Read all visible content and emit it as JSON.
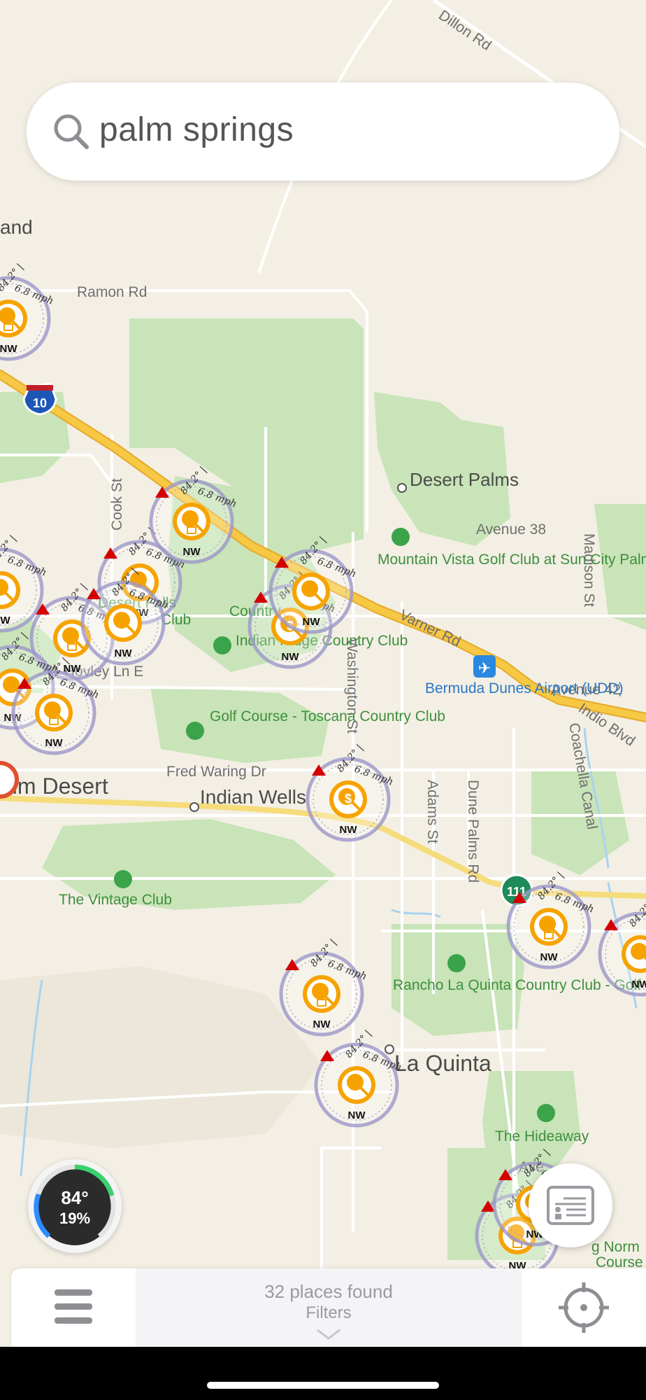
{
  "search": {
    "query": "palm springs"
  },
  "map": {
    "places": [
      {
        "name": "Desert Palms",
        "kind": "locality-sm"
      },
      {
        "name": "Mountain Vista Golf Club at Sun City Palm Desert",
        "kind": "golf"
      },
      {
        "name": "Bermuda Dunes Airport (UDD)",
        "kind": "airport"
      },
      {
        "name": "Golf Course - Toscana Country Club",
        "kind": "golf"
      },
      {
        "name": "Indian Ridge Country Club",
        "kind": "golf"
      },
      {
        "name": "Palm Desert",
        "kind": "city"
      },
      {
        "name": "Indian Wells",
        "kind": "city"
      },
      {
        "name": "The Vintage Club",
        "kind": "golf"
      },
      {
        "name": "Rancho La Quinta Country Club - Golf Course",
        "kind": "golf"
      },
      {
        "name": "La Quinta",
        "kind": "city"
      },
      {
        "name": "The Hideaway",
        "kind": "golf"
      }
    ],
    "roads": {
      "dillon": "Dillon Rd",
      "ramon": "Ramon Rd",
      "cook": "Cook St",
      "avenue38": "Avenue 38",
      "madison": "Madison St",
      "varner": "Varner Rd",
      "washington": "Washington St",
      "avenue42": "Avenue 42",
      "indio": "Indio Blvd",
      "coachella": "Coachella Canal",
      "fredwaring": "Fred Waring Dr",
      "adams": "Adams St",
      "dunepalms": "Dune Palms Rd",
      "hovley": "Hovley Ln E",
      "ave": "Ave",
      "and": "and",
      "alm": "alm Desert",
      "desertfalls": "Desert Falls",
      "club": "Club",
      "country": "Country",
      "norm": "g Norm",
      "course": "Course"
    },
    "shields": {
      "i10": "10",
      "ca111": "111"
    },
    "wind": {
      "temp_label": "84.2°",
      "speed_label": "6.8 mph",
      "dir_label": "NW"
    },
    "pins": [
      {
        "icon": "lock"
      },
      {
        "icon": "plain"
      },
      {
        "icon": "lock"
      },
      {
        "icon": "plain"
      },
      {
        "icon": "lock"
      },
      {
        "icon": "plain"
      },
      {
        "icon": "plain"
      },
      {
        "icon": "dollar"
      },
      {
        "icon": "plain"
      },
      {
        "icon": "lock"
      },
      {
        "icon": "dollar"
      },
      {
        "icon": "lock"
      },
      {
        "icon": "plain"
      },
      {
        "icon": "lock"
      },
      {
        "icon": "plain"
      },
      {
        "icon": "lock"
      },
      {
        "icon": "plain"
      }
    ],
    "colors": {
      "land": "#f3efe4",
      "park": "#c8e4b8",
      "road_main": "#ffffff",
      "highway": "#f6c843",
      "highway_edge": "#e6a92a",
      "water": "#a8d2f0",
      "pin_fill": "#f6a300",
      "pin_ring": "#9b96c8",
      "pin_arrow": "#d40000",
      "text_road": "#6f6f6f",
      "text_golf": "#3e8f3e",
      "text_airport": "#2b78c4",
      "text_city": "#4b4b4b"
    }
  },
  "weather": {
    "temp": "84°",
    "humidity": "19%"
  },
  "bottom_bar": {
    "places_found": "32 places found",
    "filters": "Filters"
  }
}
